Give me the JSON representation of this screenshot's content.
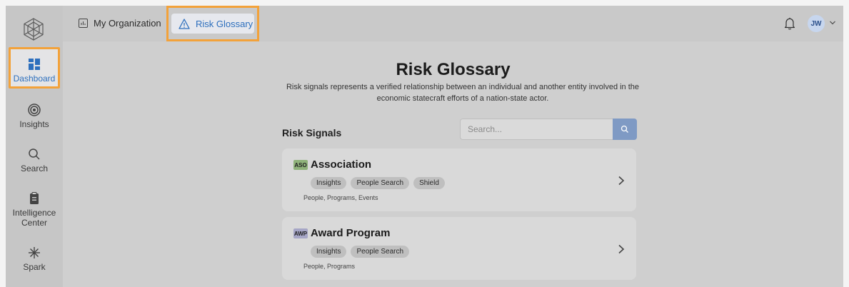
{
  "header": {
    "tabs": [
      {
        "label": "My Organization"
      },
      {
        "label": "Risk Glossary"
      }
    ],
    "user_initials": "JW"
  },
  "sidebar": {
    "items": [
      {
        "label": "Dashboard"
      },
      {
        "label": "Insights"
      },
      {
        "label": "Search"
      },
      {
        "label": "Intelligence Center"
      },
      {
        "label": "Spark"
      }
    ]
  },
  "main": {
    "title": "Risk Glossary",
    "subtitle": "Risk signals represents a verified relationship between an individual and another entity involved in the economic statecraft efforts of a nation-state actor.",
    "section_title": "Risk Signals",
    "search": {
      "placeholder": "Search..."
    },
    "cards": [
      {
        "abbr": "ASO",
        "abbr_color": "#8fb27a",
        "title": "Association",
        "tags": [
          "Insights",
          "People Search",
          "Shield"
        ],
        "meta": "People, Programs, Events"
      },
      {
        "abbr": "AWP",
        "abbr_color": "#a6a6c6",
        "title": "Award Program",
        "tags": [
          "Insights",
          "People Search"
        ],
        "meta": "People, Programs"
      }
    ]
  },
  "colors": {
    "accent": "#2d6fbd",
    "highlight_outline": "#f3a23a",
    "search_button": "#7f9ac4"
  }
}
